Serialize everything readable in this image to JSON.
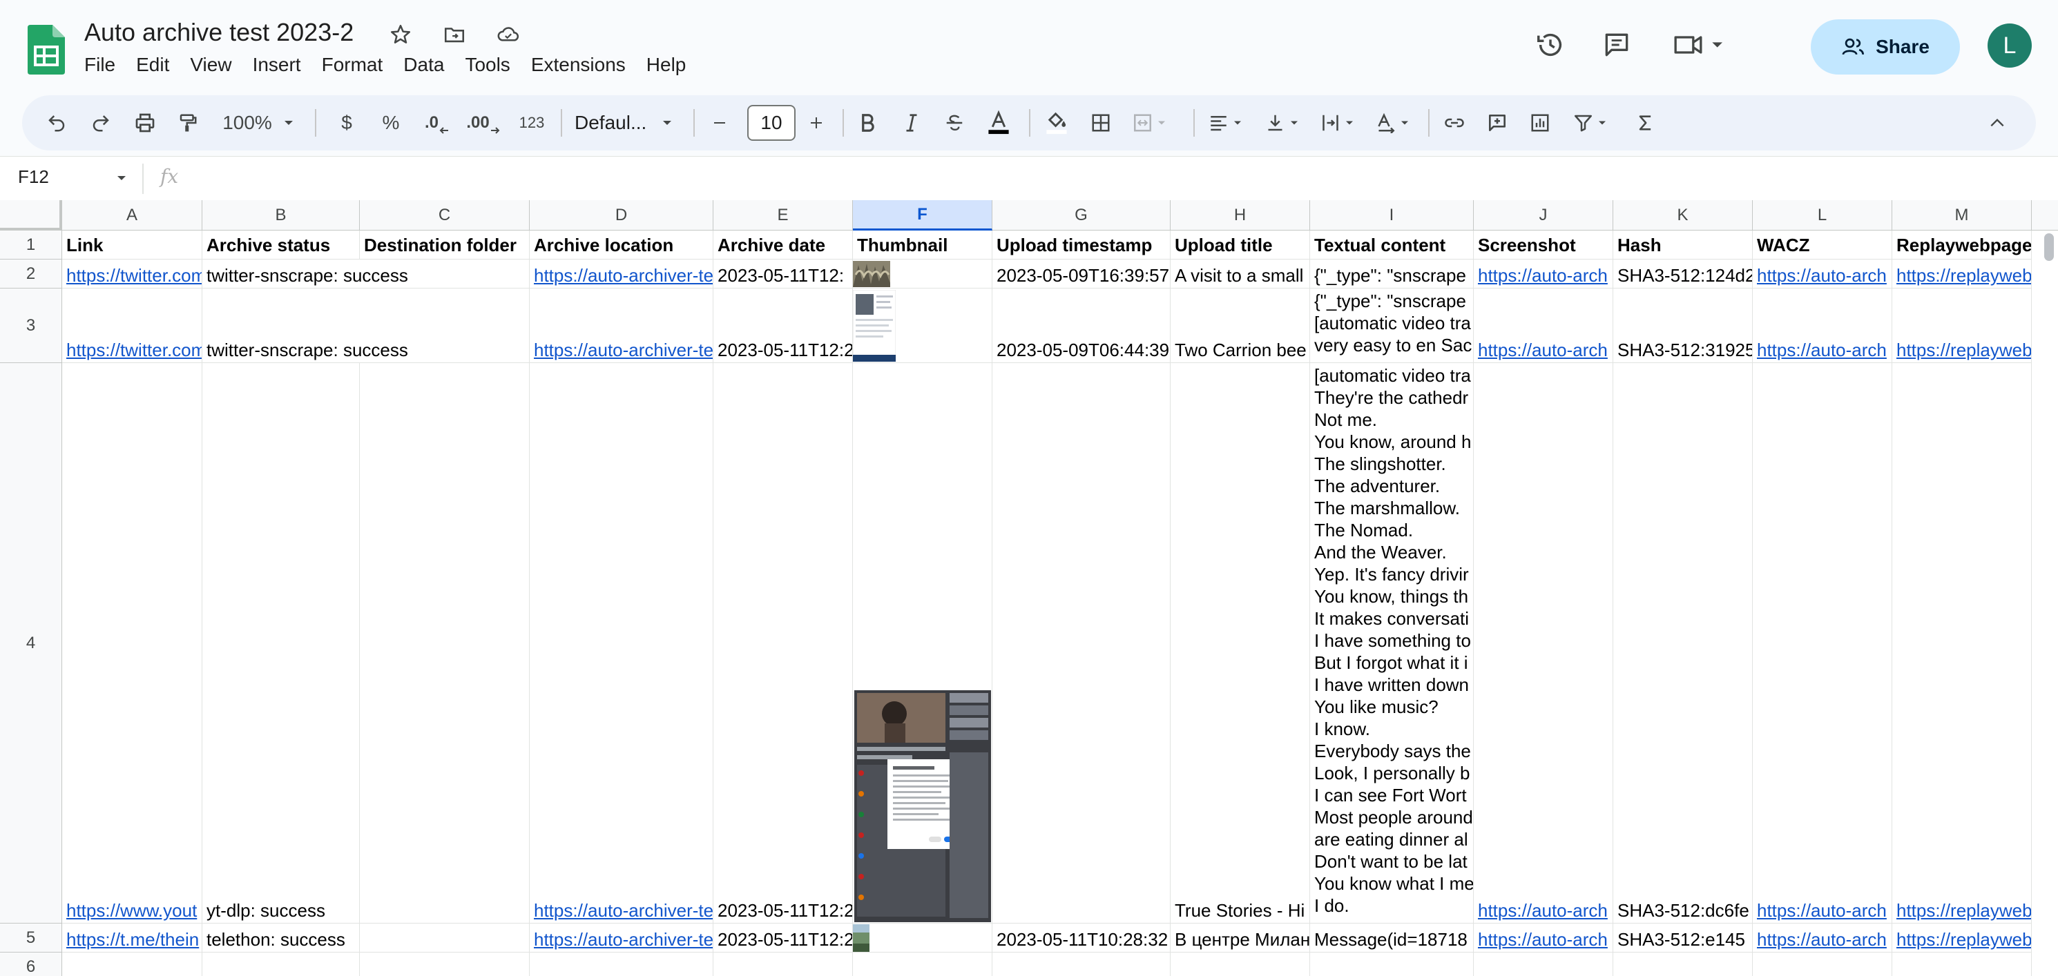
{
  "app": {
    "doc_title": "Auto archive test 2023-2",
    "menu": [
      "File",
      "Edit",
      "View",
      "Insert",
      "Format",
      "Data",
      "Tools",
      "Extensions",
      "Help"
    ],
    "share_label": "Share",
    "avatar_initial": "L",
    "accent": "#0b57d0",
    "share_bg": "#c2e7ff"
  },
  "toolbar": {
    "zoom": "100%",
    "currency": "$",
    "percent": "%",
    "decrease_decimal": ".0",
    "increase_decimal": ".00",
    "number_format": "123",
    "font_name": "Defaul...",
    "font_size": "10"
  },
  "formula_bar": {
    "cell_ref": "F12",
    "fx": "fx",
    "value": ""
  },
  "grid": {
    "columns": [
      "A",
      "B",
      "C",
      "D",
      "E",
      "F",
      "G",
      "H",
      "I",
      "J",
      "K",
      "L",
      "M"
    ],
    "selected_column": "F",
    "row_numbers": [
      "1",
      "2",
      "3",
      "4",
      "5",
      "6"
    ],
    "headers": [
      "Link",
      "Archive status",
      "Destination folder",
      "Archive location",
      "Archive date",
      "Thumbnail",
      "Upload timestamp",
      "Upload title",
      "Textual content",
      "Screenshot",
      "Hash",
      "WACZ",
      "Replaywebpage"
    ],
    "row2": {
      "link": "https://twitter.com",
      "status": "twitter-snscrape: success",
      "location": "https://auto-archiver-te",
      "date": "2023-05-11T12:",
      "upload_ts": "2023-05-09T16:39:57",
      "title": "A visit to a small",
      "text": "{\"_type\": \"snscrape",
      "screenshot": "https://auto-arch",
      "hash": "SHA3-512:124d2",
      "wacz": "https://auto-arch",
      "replay": "https://replayweb."
    },
    "row3": {
      "link": "https://twitter.com",
      "status": "twitter-snscrape: success",
      "location": "https://auto-archiver-te",
      "date": "2023-05-11T12:2",
      "upload_ts": "2023-05-09T06:44:39",
      "title": "Two Carrion bee",
      "text": "{\"_type\": \"snscrape\n[automatic video tra\nvery easy to en Sac",
      "screenshot": "https://auto-arch",
      "hash": "SHA3-512:31925",
      "wacz": "https://auto-arch",
      "replay": "https://replayweb."
    },
    "row4": {
      "link": "https://www.yout",
      "status": "yt-dlp: success",
      "location": "https://auto-archiver-te",
      "date": "2023-05-11T12:2",
      "upload_ts": "",
      "title": "True Stories - Hi",
      "text": "[automatic video tra\nThey're the cathedr\nNot me.\nYou know, around h\nThe slingshotter.\nThe adventurer.\nThe marshmallow.\nThe Nomad.\nAnd the Weaver.\nYep. It's fancy drivir\nYou know, things th\nIt makes conversati\nI have something to\nBut I forgot what it i\nI have written down\nYou like music?\nI know.\nEverybody says the\nLook, I personally b\nI can see Fort Wort\nMost people around\nare eating dinner al\nDon't want to be lat\nYou know what I me\nI do.",
      "screenshot": "https://auto-arch",
      "hash": "SHA3-512:dc6fe",
      "wacz": "https://auto-arch",
      "replay": "https://replayweb."
    },
    "row5": {
      "link": "https://t.me/thein",
      "status": "telethon: success",
      "location": "https://auto-archiver-te",
      "date": "2023-05-11T12:2",
      "upload_ts": "2023-05-11T10:28:32",
      "title": "В центре Милан",
      "text": "Message(id=18718",
      "screenshot": "https://auto-arch",
      "hash": "SHA3-512:e145",
      "wacz": "https://auto-arch",
      "replay": "https://replayweb."
    }
  }
}
